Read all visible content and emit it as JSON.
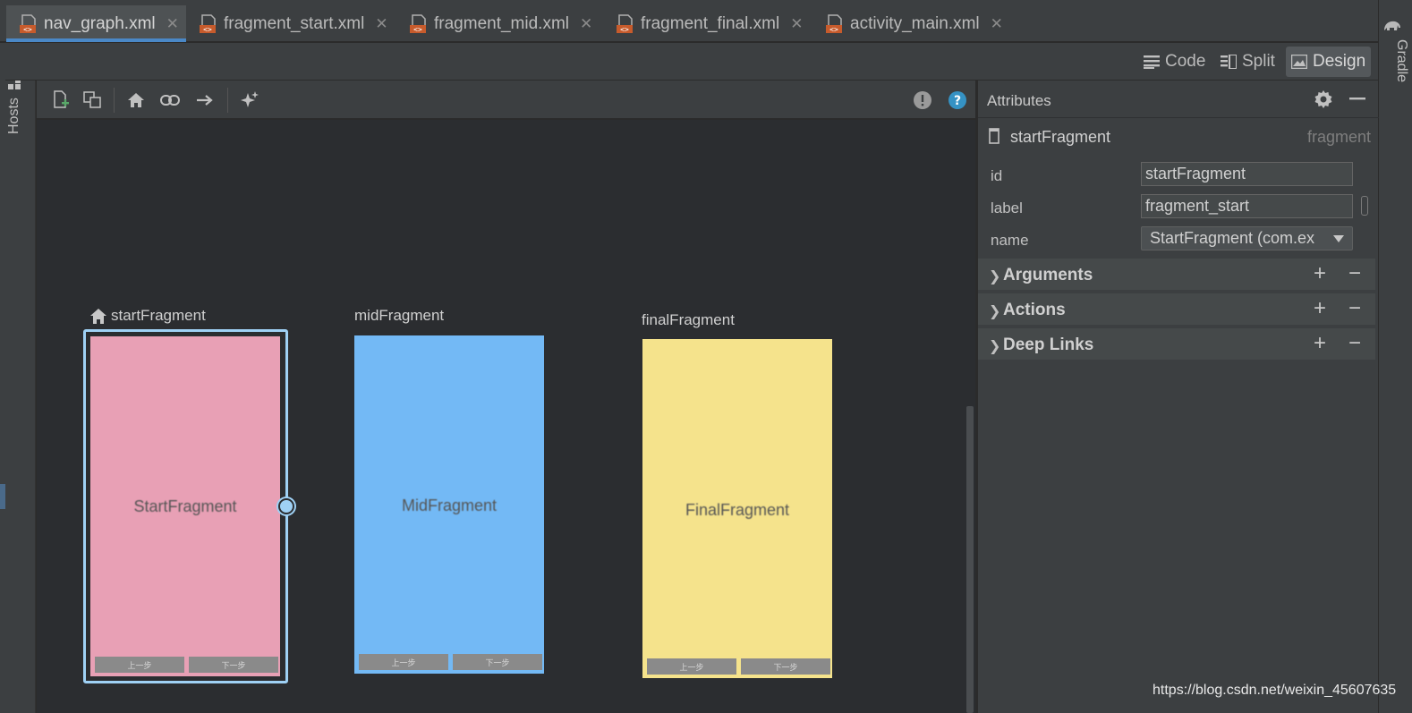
{
  "tabs": [
    {
      "label": "nav_graph.xml",
      "active": true
    },
    {
      "label": "fragment_start.xml",
      "active": false
    },
    {
      "label": "fragment_mid.xml",
      "active": false
    },
    {
      "label": "fragment_final.xml",
      "active": false
    },
    {
      "label": "activity_main.xml",
      "active": false
    }
  ],
  "view_modes": {
    "code": "Code",
    "split": "Split",
    "design": "Design",
    "active": "Design"
  },
  "side_tools": {
    "hosts": "Hosts",
    "gradle": "Gradle"
  },
  "colors": {
    "accent": "#4a88c7",
    "selection": "#9fd1f5",
    "start_fragment": "#e8a0b5",
    "mid_fragment": "#73b9f5",
    "final_fragment": "#f5e38c",
    "help": "#3592c4"
  },
  "canvas": {
    "fragments": [
      {
        "title": "startFragment",
        "label": "StartFragment",
        "is_start": true,
        "selected": true,
        "buttons": [
          "上一步",
          "下一步"
        ]
      },
      {
        "title": "midFragment",
        "label": "MidFragment",
        "is_start": false,
        "selected": false,
        "buttons": [
          "上一步",
          "下一步"
        ]
      },
      {
        "title": "finalFragment",
        "label": "FinalFragment",
        "is_start": false,
        "selected": false,
        "buttons": [
          "上一步",
          "下一步"
        ]
      }
    ]
  },
  "attributes": {
    "title": "Attributes",
    "selected_name": "startFragment",
    "selected_type": "fragment",
    "props": {
      "id_label": "id",
      "id_value": "startFragment",
      "label_label": "label",
      "label_value": "fragment_start",
      "name_label": "name",
      "name_value": "StartFragment (com.ex"
    },
    "sections": [
      "Arguments",
      "Actions",
      "Deep Links"
    ]
  },
  "watermark": "https://blog.csdn.net/weixin_45607635"
}
